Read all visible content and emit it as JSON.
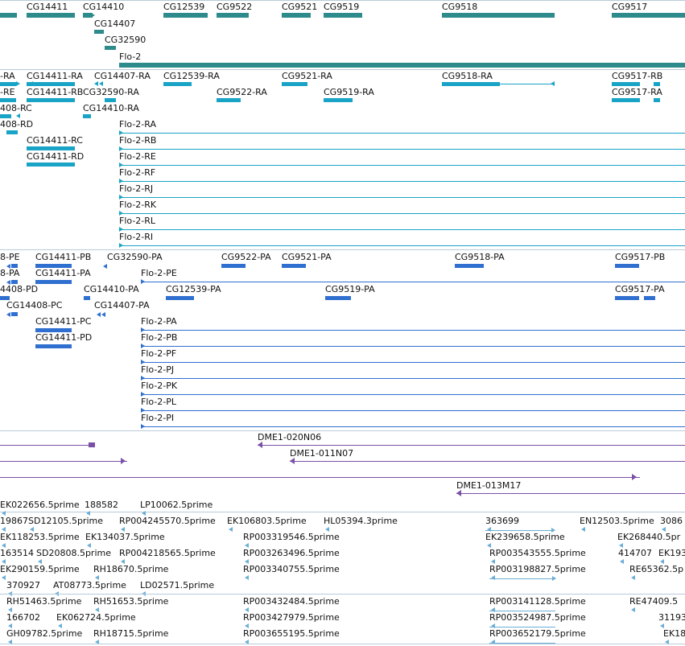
{
  "colors": {
    "gene": "#2e8b8b",
    "transcript": "#19a3c6",
    "protein": "#2f6fd0",
    "clone": "#7b4fa6",
    "est": "#6aaed6",
    "separator": "#b9cbd9"
  },
  "tracks": {
    "genes": [
      {
        "label": "CG14411"
      },
      {
        "label": "CG14410"
      },
      {
        "label": "CG12539"
      },
      {
        "label": "CG9522"
      },
      {
        "label": "CG9521"
      },
      {
        "label": "CG9519"
      },
      {
        "label": "CG9518"
      },
      {
        "label": "CG9517"
      },
      {
        "label": "CG14407"
      },
      {
        "label": "CG32590"
      },
      {
        "label": "Flo-2"
      }
    ],
    "transcripts": [
      {
        "label": "-RA"
      },
      {
        "label": "CG14411-RA"
      },
      {
        "label": "CG14407-RA"
      },
      {
        "label": "CG12539-RA"
      },
      {
        "label": "CG9521-RA"
      },
      {
        "label": "CG9518-RA"
      },
      {
        "label": "CG9517-RB"
      },
      {
        "label": "-RE"
      },
      {
        "label": "CG14411-RB"
      },
      {
        "label": "CG32590-RA"
      },
      {
        "label": "CG9522-RA"
      },
      {
        "label": "CG9519-RA"
      },
      {
        "label": "CG9517-RA"
      },
      {
        "label": "408-RC"
      },
      {
        "label": "CG14410-RA"
      },
      {
        "label": "408-RD"
      },
      {
        "label": "Flo-2-RA"
      },
      {
        "label": "CG14411-RC"
      },
      {
        "label": "Flo-2-RB"
      },
      {
        "label": "CG14411-RD"
      },
      {
        "label": "Flo-2-RE"
      },
      {
        "label": "Flo-2-RF"
      },
      {
        "label": "Flo-2-RJ"
      },
      {
        "label": "Flo-2-RK"
      },
      {
        "label": "Flo-2-RL"
      },
      {
        "label": "Flo-2-RI"
      }
    ],
    "proteins": [
      {
        "label": "8-PE"
      },
      {
        "label": "CG14411-PB"
      },
      {
        "label": "CG32590-PA"
      },
      {
        "label": "CG9522-PA"
      },
      {
        "label": "CG9521-PA"
      },
      {
        "label": "CG9518-PA"
      },
      {
        "label": "CG9517-PB"
      },
      {
        "label": "8-PA"
      },
      {
        "label": "CG14411-PA"
      },
      {
        "label": "Flo-2-PE"
      },
      {
        "label": "4408-PD"
      },
      {
        "label": "CG14410-PA"
      },
      {
        "label": "CG12539-PA"
      },
      {
        "label": "CG9519-PA"
      },
      {
        "label": "CG9517-PA"
      },
      {
        "label": "CG14408-PC"
      },
      {
        "label": "CG14407-PA"
      },
      {
        "label": "CG14411-PC"
      },
      {
        "label": "Flo-2-PA"
      },
      {
        "label": "CG14411-PD"
      },
      {
        "label": "Flo-2-PB"
      },
      {
        "label": "Flo-2-PF"
      },
      {
        "label": "Flo-2-PJ"
      },
      {
        "label": "Flo-2-PK"
      },
      {
        "label": "Flo-2-PL"
      },
      {
        "label": "Flo-2-PI"
      }
    ],
    "clones": [
      {
        "label": "DME1-020N06"
      },
      {
        "label": "DME1-011N07"
      },
      {
        "label": "DME1-013M17"
      }
    ],
    "ests": [
      {
        "label": "EK022656.5prime"
      },
      {
        "label": "188582"
      },
      {
        "label": "LP10062.5prime"
      },
      {
        "label": "19867"
      },
      {
        "label": "SD12105.5prime"
      },
      {
        "label": "RP004245570.5prime"
      },
      {
        "label": "EK106803.5prime"
      },
      {
        "label": "HL05394.3prime"
      },
      {
        "label": "363699"
      },
      {
        "label": "EN12503.5prime"
      },
      {
        "label": "3086"
      },
      {
        "label": "EK118253.5prime"
      },
      {
        "label": "EK134037.5prime"
      },
      {
        "label": "RP003319546.5prime"
      },
      {
        "label": "EK239658.5prime"
      },
      {
        "label": "EK268440.5pr"
      },
      {
        "label": "163514"
      },
      {
        "label": "SD20808.5prime"
      },
      {
        "label": "RP004218565.5prime"
      },
      {
        "label": "RP003263496.5prime"
      },
      {
        "label": "RP003543555.5prime"
      },
      {
        "label": "414707"
      },
      {
        "label": "EK193"
      },
      {
        "label": "EK290159.5prime"
      },
      {
        "label": "RH18670.5prime"
      },
      {
        "label": "RP003340755.5prime"
      },
      {
        "label": "RP003198827.5prime"
      },
      {
        "label": "RE65362.5p"
      },
      {
        "label": "370927"
      },
      {
        "label": "AT08773.5prime"
      },
      {
        "label": "LD02571.5prime"
      },
      {
        "label": "RH51463.5prime"
      },
      {
        "label": "RH51653.5prime"
      },
      {
        "label": "RP003432484.5prime"
      },
      {
        "label": "RP003141128.5prime"
      },
      {
        "label": "RE47409.5"
      },
      {
        "label": "166702"
      },
      {
        "label": "EK062724.5prime"
      },
      {
        "label": "RP003427979.5prime"
      },
      {
        "label": "RP003524987.5prime"
      },
      {
        "label": "31193"
      },
      {
        "label": "GH09782.5prime"
      },
      {
        "label": "RH18715.5prime"
      },
      {
        "label": "RP003655195.5prime"
      },
      {
        "label": "RP003652179.5prime"
      },
      {
        "label": "EK18"
      }
    ]
  }
}
